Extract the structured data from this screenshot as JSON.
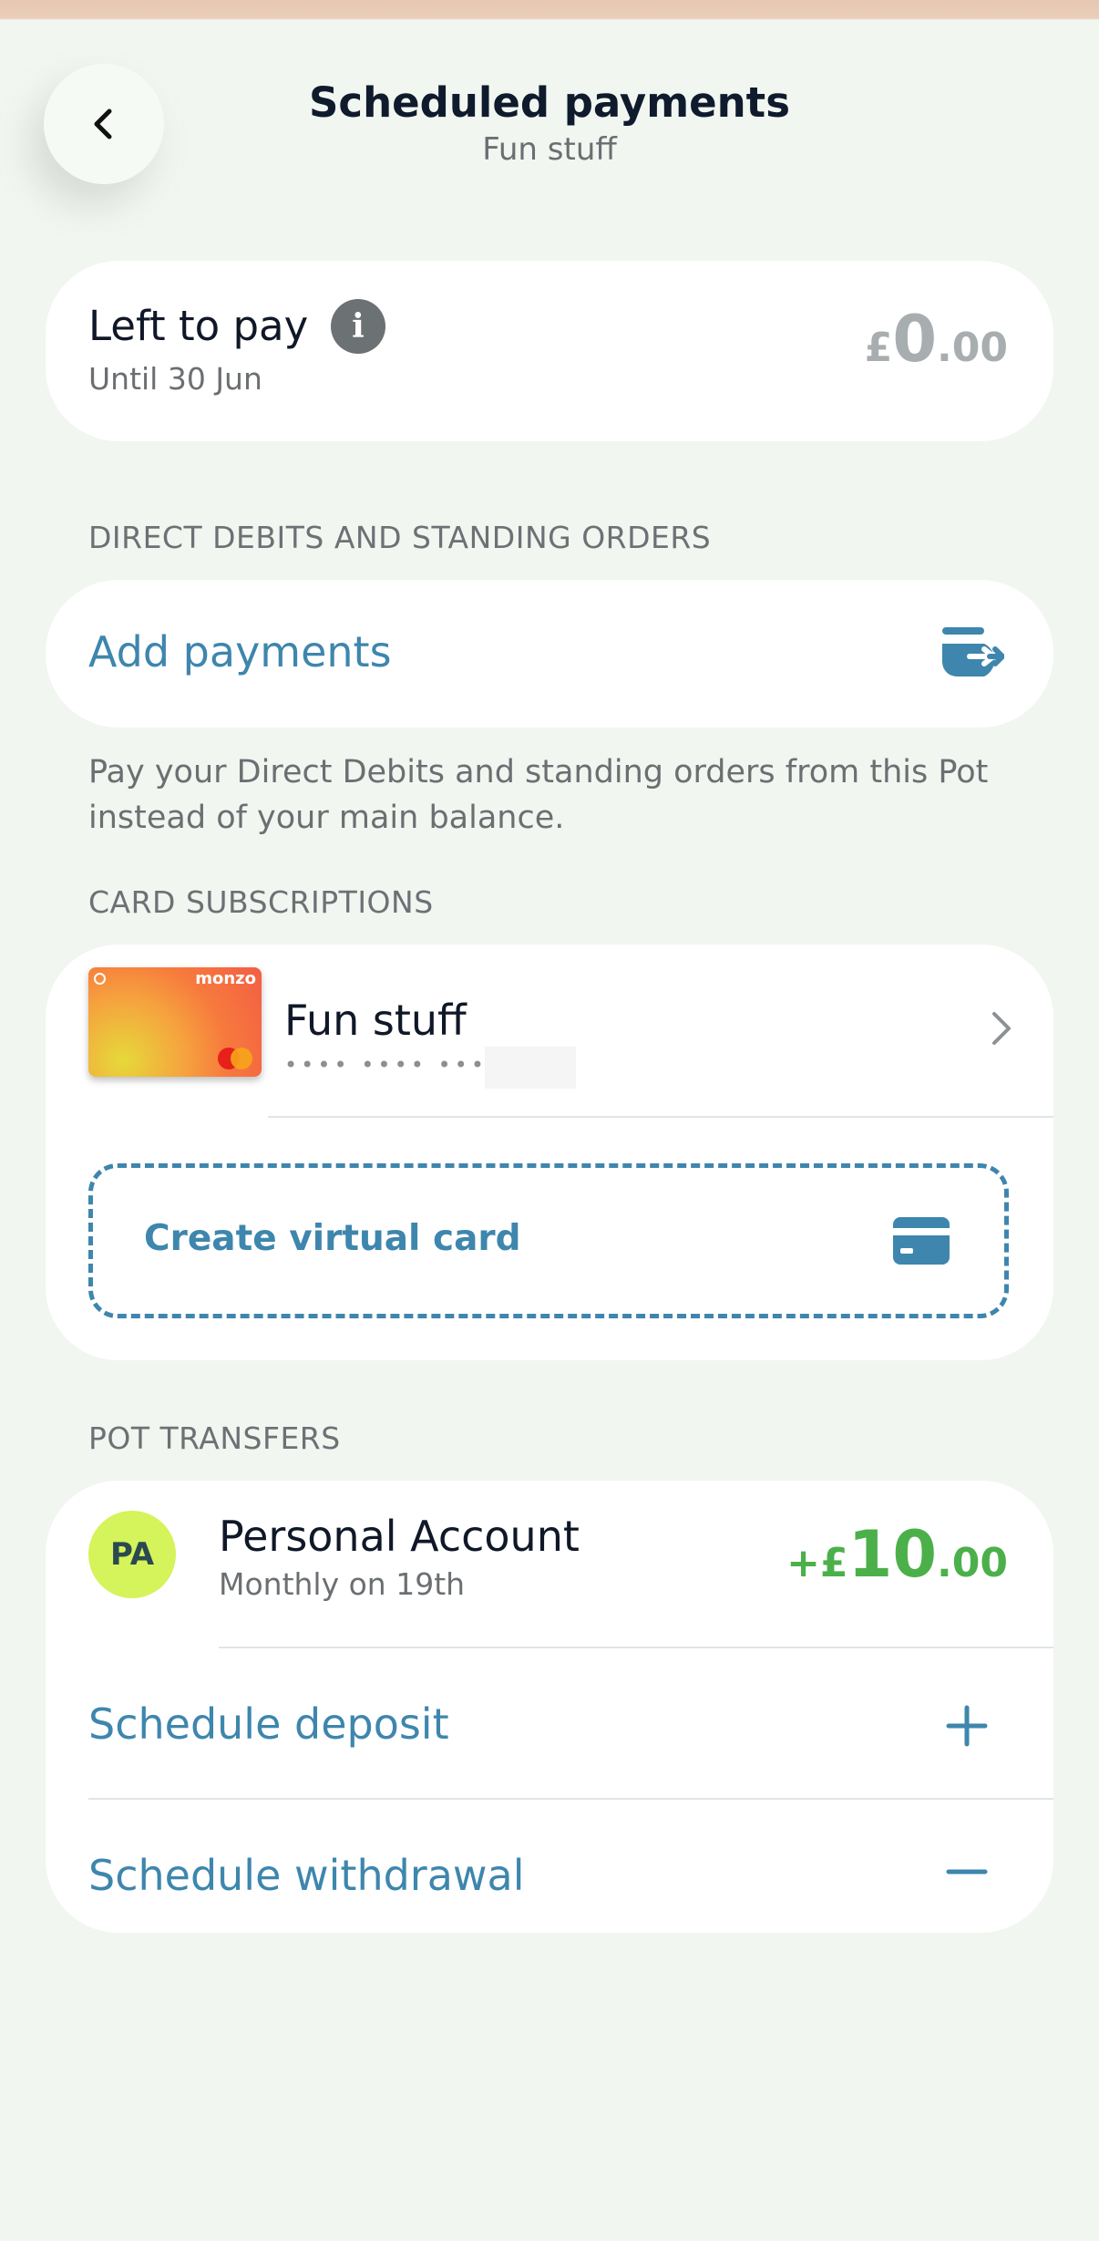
{
  "header": {
    "title": "Scheduled payments",
    "subtitle": "Fun stuff"
  },
  "left_to_pay": {
    "label": "Left to pay",
    "until": "Until 30 Jun",
    "currency": "£",
    "amount_major": "0",
    "amount_minor": ".00"
  },
  "direct_debits": {
    "section_label": "DIRECT DEBITS AND STANDING ORDERS",
    "add_label": "Add payments",
    "description": "Pay your Direct Debits and standing orders from this Pot instead of your main balance."
  },
  "card_subscriptions": {
    "section_label": "CARD SUBSCRIPTIONS",
    "card_brand": "monzo",
    "card_name": "Fun stuff",
    "card_mask": "•••• •••• ••••",
    "create_label": "Create virtual card"
  },
  "pot_transfers": {
    "section_label": "POT TRANSFERS",
    "avatar": "PA",
    "account_name": "Personal Account",
    "schedule": "Monthly on 19th",
    "amount_prefix": "+£",
    "amount_major": "10",
    "amount_minor": ".00",
    "deposit_label": "Schedule deposit",
    "withdrawal_label": "Schedule withdrawal"
  },
  "colors": {
    "accent": "#3e86ad",
    "positive": "#4bb04a",
    "background": "#f1f6f0"
  }
}
